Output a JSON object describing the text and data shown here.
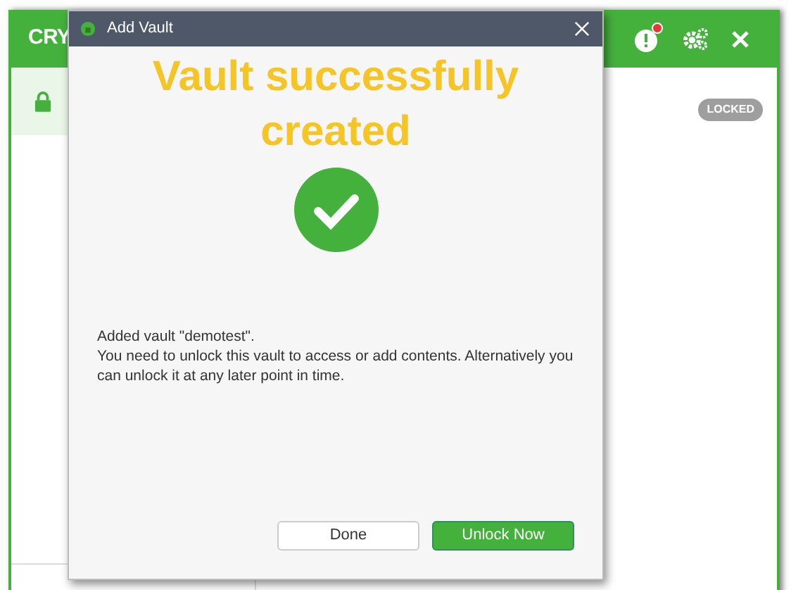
{
  "app": {
    "title": "CRY",
    "alert_dot": true,
    "vault_status": "LOCKED",
    "vault_selected": true
  },
  "dialog": {
    "title": "Add Vault",
    "heading": "Vault successfully created",
    "message": [
      "Added vault \"demotest\".",
      "You need to unlock this vault to access or add contents. Alternatively you can unlock it at any later point in time."
    ],
    "buttons": [
      {
        "label": "Done",
        "kind": "secondary"
      },
      {
        "label": "Unlock Now",
        "kind": "primary"
      }
    ]
  }
}
